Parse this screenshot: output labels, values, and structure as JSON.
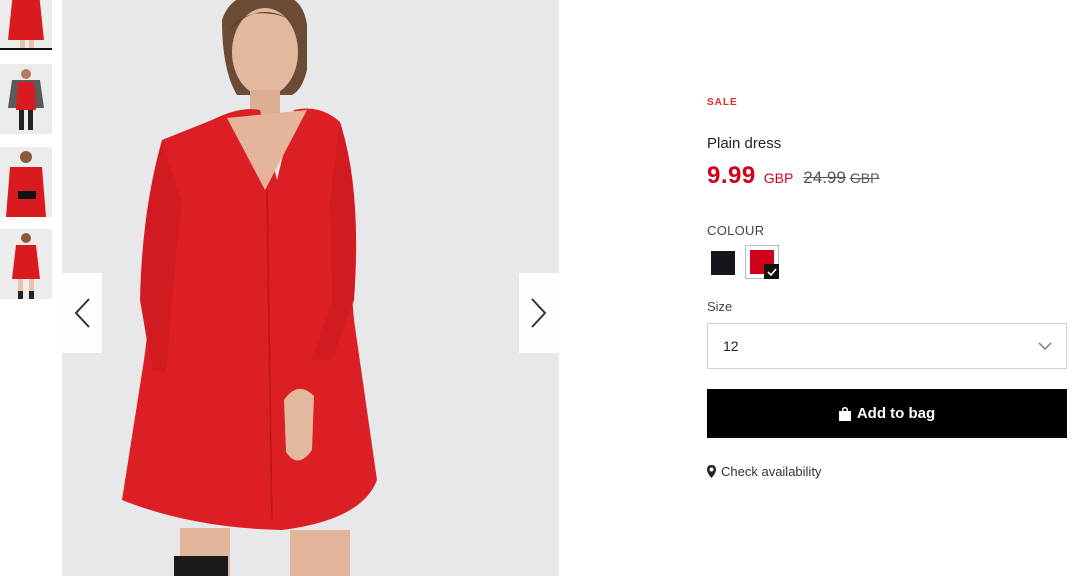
{
  "product": {
    "badge": "SALE",
    "name": "Plain dress",
    "price": {
      "current": "9.99",
      "current_currency": "GBP",
      "original": "24.99",
      "original_currency": "GBP"
    }
  },
  "colour": {
    "label": "COLOUR",
    "options": [
      {
        "name": "black",
        "hex": "#15151c",
        "selected": false
      },
      {
        "name": "red",
        "hex": "#d0021b",
        "selected": true
      }
    ]
  },
  "size": {
    "label": "Size",
    "selected": "12"
  },
  "actions": {
    "add_to_bag": "Add to bag",
    "check_availability": "Check availability"
  },
  "gallery": {
    "thumbnails": [
      "dress-front-thumbnail",
      "dress-side-thumbnail",
      "dress-belted-thumbnail",
      "dress-back-thumbnail"
    ],
    "active_index": 0
  },
  "icons": {
    "prev": "chevron-left-icon",
    "next": "chevron-right-icon",
    "bag": "shopping-bag-icon",
    "location": "location-pin-icon",
    "dropdown": "chevron-down-icon",
    "check": "checkmark-icon"
  },
  "colors": {
    "sale_red": "#e12a2a",
    "price_red": "#d0021b",
    "button": "#000000"
  }
}
